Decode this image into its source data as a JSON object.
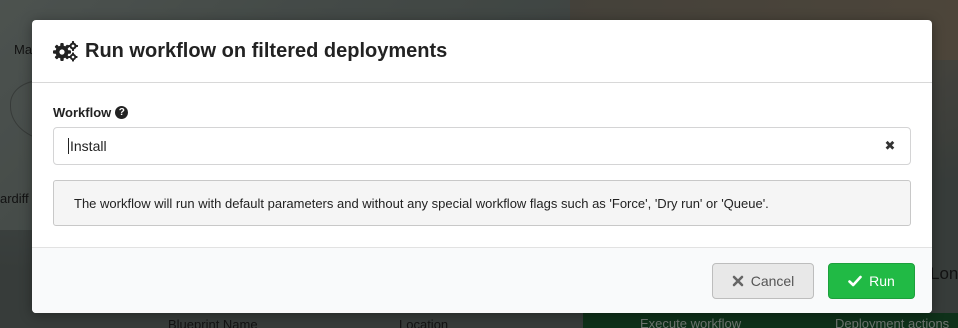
{
  "background": {
    "text_left_top": "Ma",
    "text_left_mid": "ardiff",
    "text_right": "Lon",
    "table_headers": [
      "Blueprint Name",
      "Location"
    ],
    "action_buttons": [
      "Execute workflow",
      "Deployment actions"
    ]
  },
  "modal": {
    "title": "Run workflow on filtered deployments",
    "title_icon": "cogs-icon",
    "workflow_label": "Workflow",
    "help_icon": "question-circle-icon",
    "workflow_value": "Install",
    "clear_icon": "close-icon",
    "info_message": "The workflow will run with default parameters and without any special workflow flags such as 'Force', 'Dry run' or 'Queue'.",
    "cancel_label": "Cancel",
    "run_label": "Run"
  },
  "colors": {
    "run_button": "#21ba45",
    "info_bg": "#f5f5f5",
    "overlay": "rgba(0,0,0,0.45)"
  }
}
